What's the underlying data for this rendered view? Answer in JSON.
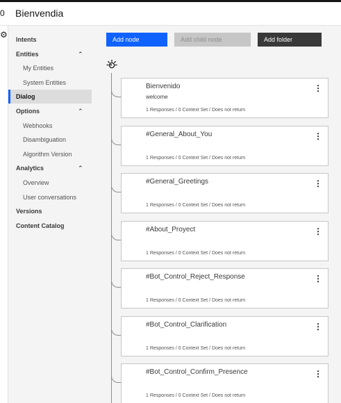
{
  "header": {
    "title": "Bienvendia",
    "edge_glyph": "0"
  },
  "rail": {
    "icon": "settings-icon",
    "glyph": "⚙"
  },
  "sidebar": {
    "items": [
      {
        "label": "Intents",
        "kind": "top"
      },
      {
        "label": "Entities",
        "kind": "section",
        "expanded": true
      },
      {
        "label": "My Entities",
        "kind": "sub"
      },
      {
        "label": "System Entities",
        "kind": "sub"
      },
      {
        "label": "Dialog",
        "kind": "top",
        "active": true
      },
      {
        "label": "Options",
        "kind": "section",
        "expanded": true
      },
      {
        "label": "Webhooks",
        "kind": "sub"
      },
      {
        "label": "Disambiguation",
        "kind": "sub"
      },
      {
        "label": "Algorithm Version",
        "kind": "sub"
      },
      {
        "label": "Analytics",
        "kind": "section",
        "expanded": true
      },
      {
        "label": "Overview",
        "kind": "sub"
      },
      {
        "label": "User conversations",
        "kind": "sub"
      },
      {
        "label": "Versions",
        "kind": "top"
      },
      {
        "label": "Content Catalog",
        "kind": "top"
      }
    ],
    "chevron_glyph": "⌃"
  },
  "toolbar": {
    "add_node": "Add node",
    "add_child_node": "Add child node",
    "add_folder": "Add folder"
  },
  "tree": {
    "root_icon": "watson-icon",
    "kebab_glyph": "⋮",
    "nodes": [
      {
        "title": "Bienvenido",
        "condition": "welcome",
        "meta": "1 Responses / 0 Context Set / Does not return"
      },
      {
        "title": "#General_About_You",
        "condition": "",
        "meta": "1 Responses / 0 Context Set / Does not return"
      },
      {
        "title": "#General_Greetings",
        "condition": "",
        "meta": "1 Responses / 0 Context Set / Does not return"
      },
      {
        "title": "#About_Proyect",
        "condition": "",
        "meta": "1 Responses / 0 Context Set / Does not return"
      },
      {
        "title": "#Bot_Control_Reject_Response",
        "condition": "",
        "meta": "1 Responses / 0 Context Set / Does not return"
      },
      {
        "title": "#Bot_Control_Clarification",
        "condition": "",
        "meta": "1 Responses / 0 Context Set / Does not return"
      },
      {
        "title": "#Bot_Control_Confirm_Presence",
        "condition": "",
        "meta": "1 Responses / 0 Context Set / Does not return"
      }
    ]
  },
  "colors": {
    "primary": "#0f62fe",
    "dark_button": "#393939",
    "disabled_button": "#c6c6c6",
    "sidebar_bg": "#f4f4f4",
    "active_item_bg": "#dcdcdc"
  }
}
